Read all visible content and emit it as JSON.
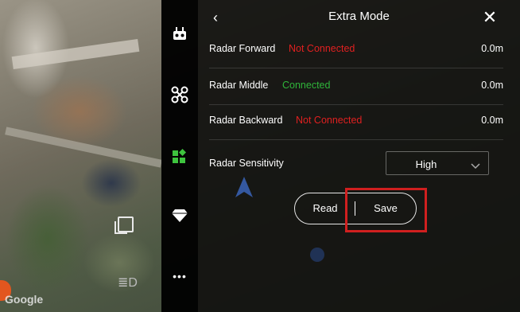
{
  "map": {
    "brand": "Google"
  },
  "toolbar": {
    "items": [
      {
        "icon": "remote-controller-icon"
      },
      {
        "icon": "drone-icon"
      },
      {
        "icon": "extra-mode-icon",
        "active": true,
        "color": "#3ec43e"
      },
      {
        "icon": "gem-icon"
      },
      {
        "icon": "more-icon",
        "label": "•••"
      }
    ]
  },
  "header": {
    "back": "‹",
    "title": "Extra Mode",
    "close": "✕"
  },
  "rows": [
    {
      "label": "Radar Forward",
      "status": "Not Connected",
      "status_color": "#e02020",
      "value": "0.0m"
    },
    {
      "label": "Radar Middle",
      "status": "Connected",
      "status_color": "#2fb53a",
      "value": "0.0m"
    },
    {
      "label": "Radar Backward",
      "status": "Not Connected",
      "status_color": "#e02020",
      "value": "0.0m"
    }
  ],
  "sensitivity": {
    "label": "Radar Sensitivity",
    "value": "High"
  },
  "actions": {
    "read": "Read",
    "save": "Save"
  },
  "colors": {
    "highlight": "#d01f1f",
    "active_icon": "#3ec43e"
  }
}
